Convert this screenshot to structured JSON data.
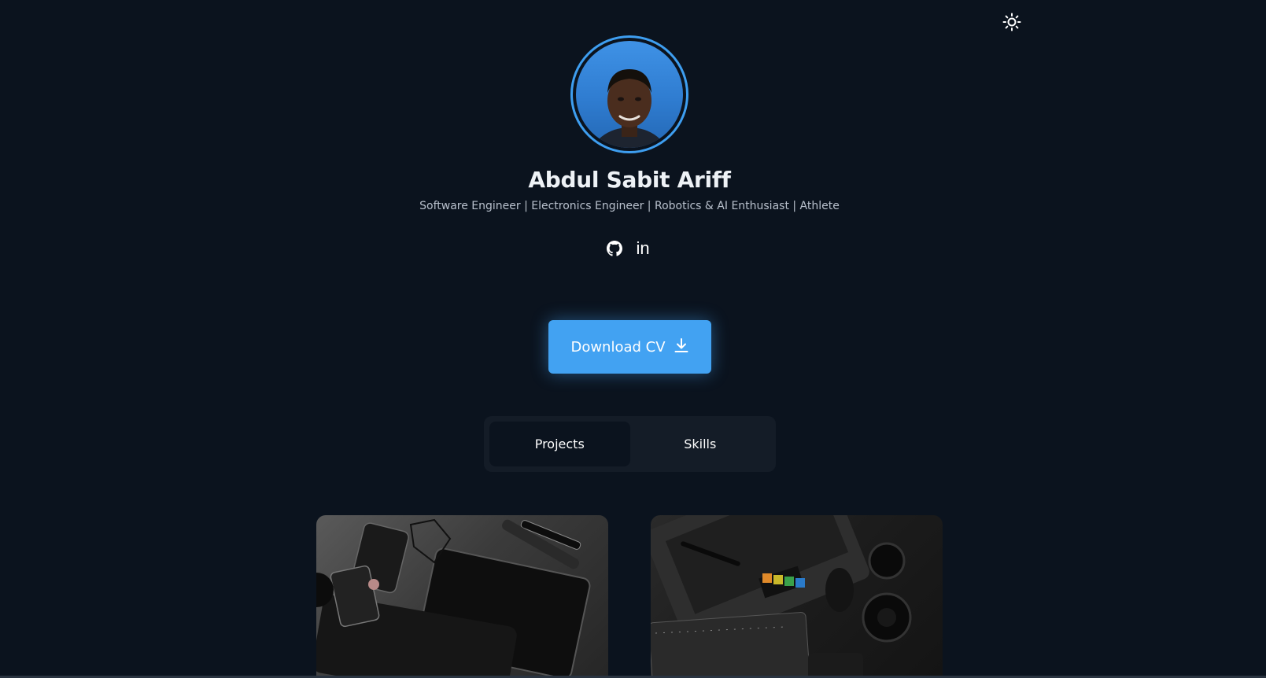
{
  "header": {
    "theme_toggle_icon": "sun-icon"
  },
  "profile": {
    "name": "Abdul Sabit Ariff",
    "tagline": "Software Engineer | Electronics Engineer | Robotics & AI Enthusiast | Athlete",
    "accent_color": "#42a2f2"
  },
  "socials": [
    {
      "icon": "github-icon"
    },
    {
      "icon": "linkedin-icon",
      "glyph": "in"
    }
  ],
  "cta": {
    "label": "Download CV",
    "icon": "download-icon"
  },
  "tabs": [
    {
      "label": "Projects",
      "active": true
    },
    {
      "label": "Skills",
      "active": false
    }
  ],
  "projects": [
    {
      "image": "desk-gadgets-photo"
    },
    {
      "image": "laptop-camera-photo"
    }
  ]
}
